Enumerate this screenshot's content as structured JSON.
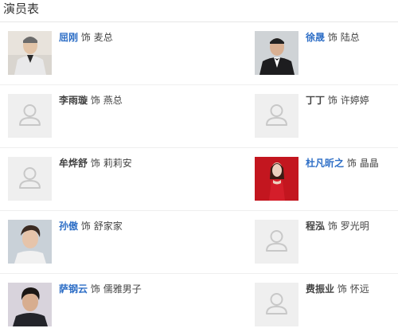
{
  "header": {
    "title": "演员表"
  },
  "cast": [
    {
      "left": {
        "actor": "屈刚",
        "linked": true,
        "connector": "饰",
        "role": "麦总",
        "photo": "person-photo-grey-suit"
      },
      "right": {
        "actor": "徐晟",
        "linked": true,
        "connector": "饰",
        "role": "陆总",
        "photo": "person-photo-tuxedo"
      }
    },
    {
      "left": {
        "actor": "李雨璇",
        "linked": false,
        "connector": "饰",
        "role": "燕总",
        "photo": "placeholder-avatar-icon"
      },
      "right": {
        "actor": "丁丁",
        "linked": false,
        "connector": "饰",
        "role": "许婷婷",
        "photo": "placeholder-avatar-icon"
      }
    },
    {
      "left": {
        "actor": "牟烨舒",
        "linked": false,
        "connector": "饰",
        "role": "莉莉安",
        "photo": "placeholder-avatar-icon"
      },
      "right": {
        "actor": "杜凡昕之",
        "linked": true,
        "connector": "饰",
        "role": "晶晶",
        "photo": "person-photo-red-dress"
      }
    },
    {
      "left": {
        "actor": "孙傲",
        "linked": true,
        "connector": "饰",
        "role": "舒家家",
        "photo": "person-photo-young-man"
      },
      "right": {
        "actor": "程泓",
        "linked": false,
        "connector": "饰",
        "role": "罗光明",
        "photo": "placeholder-avatar-icon"
      }
    },
    {
      "left": {
        "actor": "萨钢云",
        "linked": true,
        "connector": "饰",
        "role": "儒雅男子",
        "photo": "person-photo-dark-hair"
      },
      "right": {
        "actor": "费振业",
        "linked": false,
        "connector": "饰",
        "role": "怀远",
        "photo": "placeholder-avatar-icon"
      }
    }
  ],
  "colors": {
    "link": "#2d6ec6",
    "text": "#444444",
    "placeholder_bg": "#efefef",
    "placeholder_icon": "#c8c8c8"
  }
}
